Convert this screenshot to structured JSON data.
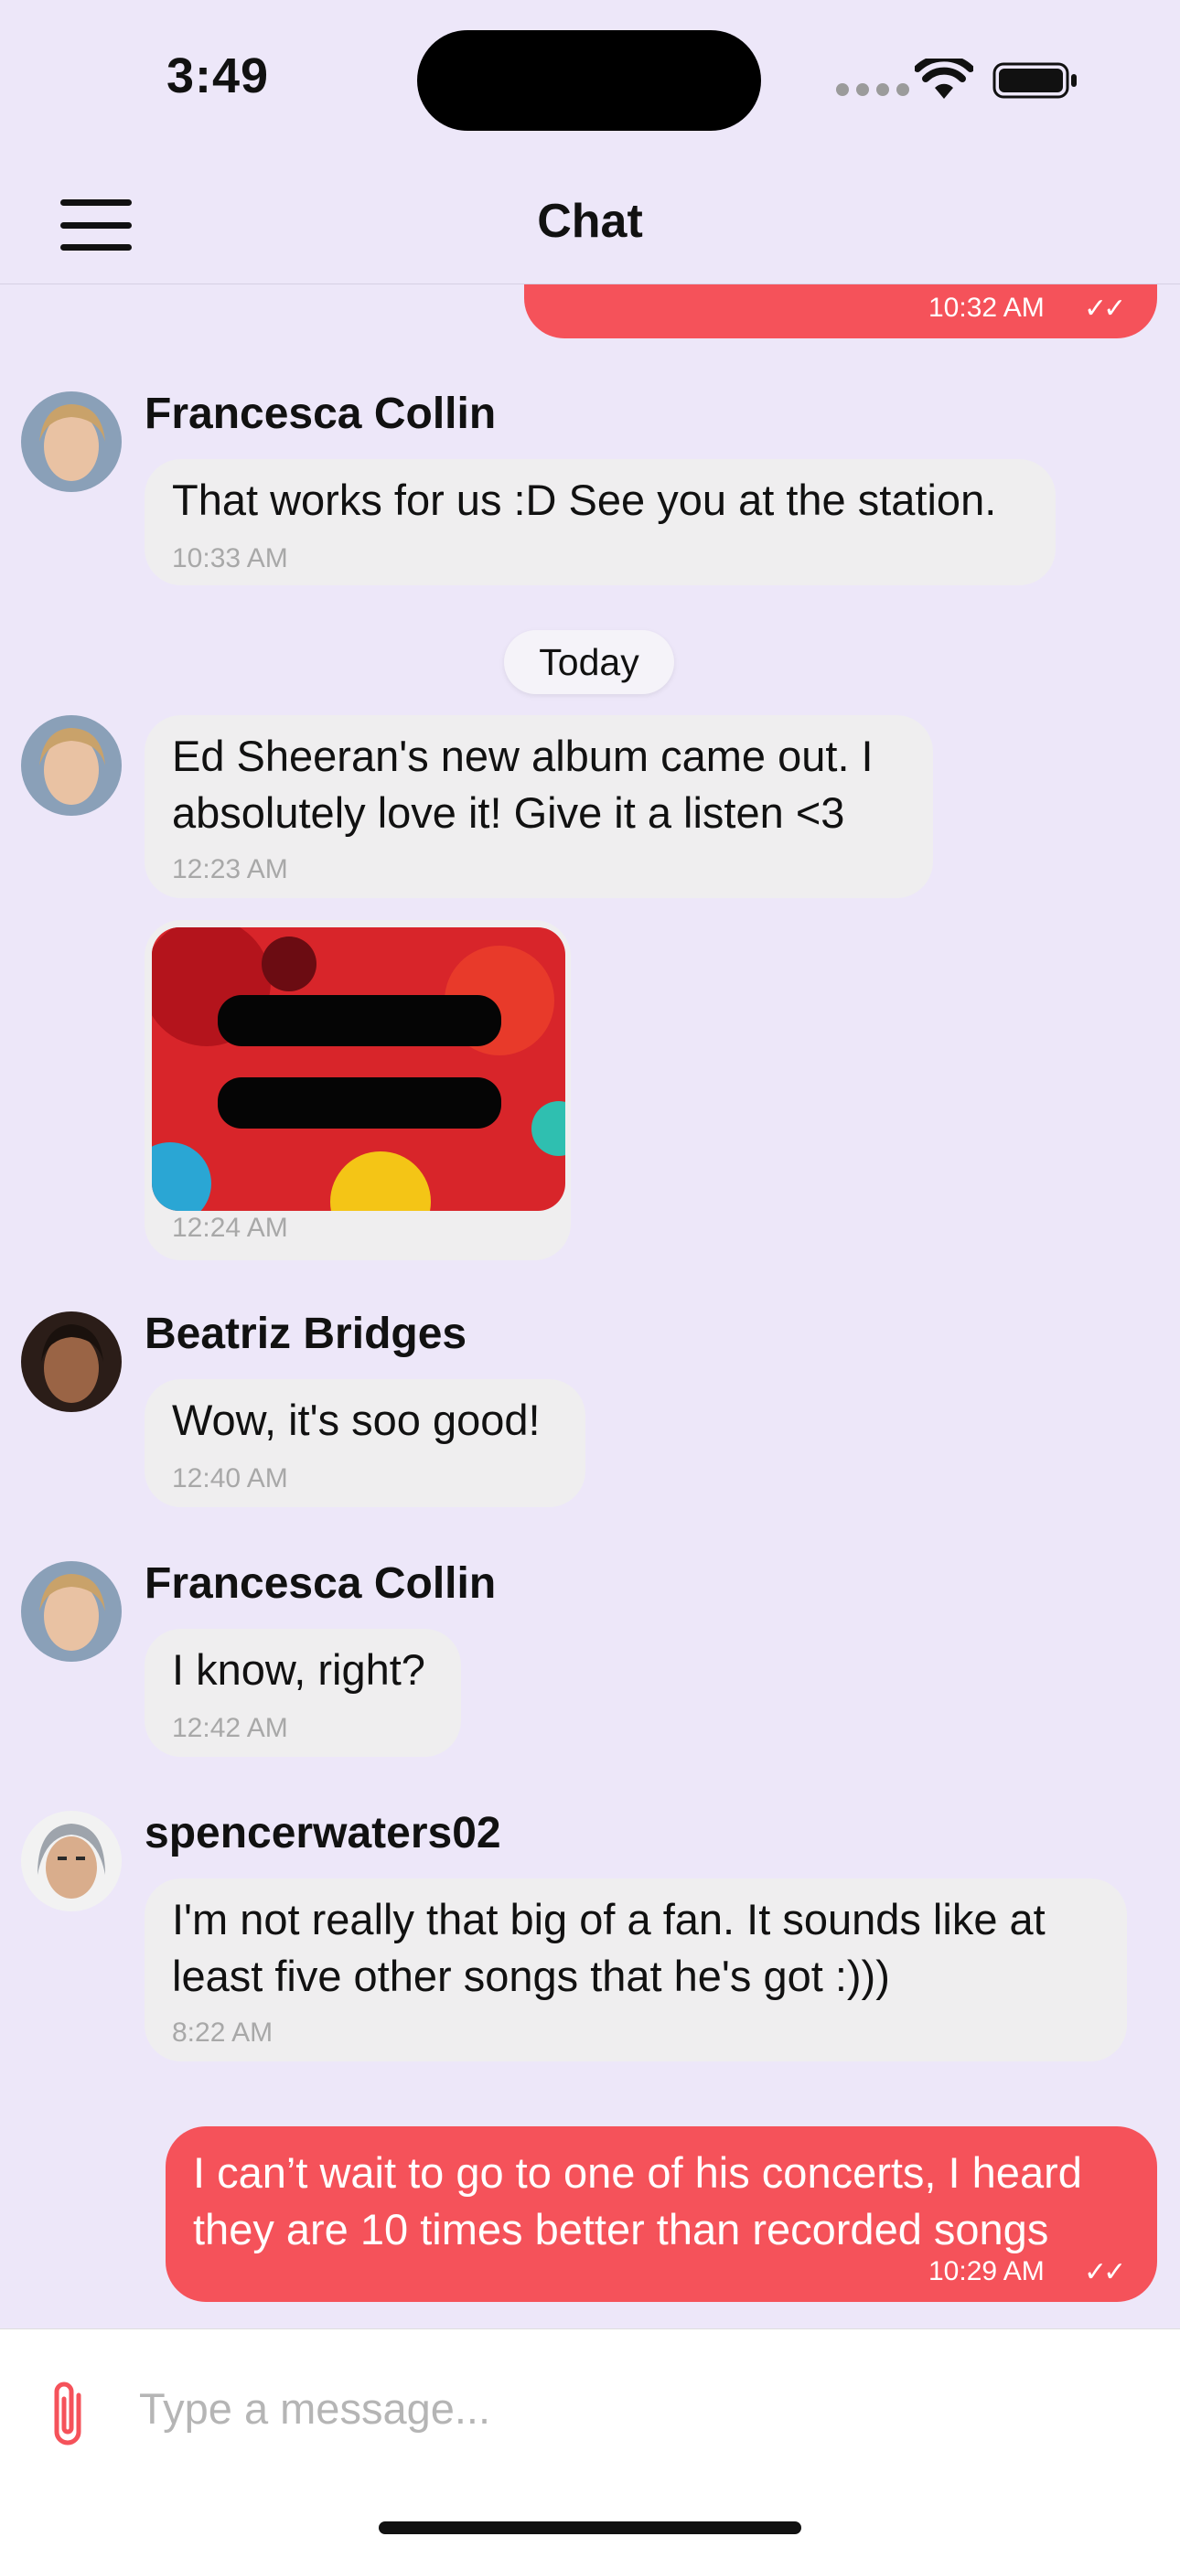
{
  "status_bar": {
    "time": "3:49"
  },
  "header": {
    "title": "Chat"
  },
  "messages": [
    {
      "direction": "out",
      "time": "10:32 AM",
      "ticks": "✓✓"
    },
    {
      "direction": "in",
      "sender": "Francesca Collin",
      "text": "That works for us :D See you at the station.",
      "time": "10:33 AM"
    },
    {
      "direction": "in",
      "sender": "",
      "text": "Ed Sheeran's new album came out. I absolutely love it! Give it a listen <3",
      "time": "12:23 AM"
    },
    {
      "direction": "in",
      "sender": "",
      "image": "album-cover",
      "time": "12:24 AM"
    },
    {
      "direction": "in",
      "sender": "Beatriz Bridges",
      "text": "Wow, it's soo good!",
      "time": "12:40 AM"
    },
    {
      "direction": "in",
      "sender": "Francesca Collin",
      "text": "I know, right?",
      "time": "12:42 AM"
    },
    {
      "direction": "in",
      "sender": "spencerwaters02",
      "text": "I'm not really that big of a fan. It sounds like at least five other songs that he's got :)))",
      "time": "8:22 AM"
    },
    {
      "direction": "out",
      "text": "I can’t wait to go to one of his concerts, I heard they are 10 times better than recorded songs",
      "time": "10:29 AM",
      "ticks": "✓✓"
    }
  ],
  "day_separator": "Today",
  "composer": {
    "placeholder": "Type a message..."
  },
  "colors": {
    "background": "#ede7f9",
    "outgoing_bubble": "#f5525a",
    "incoming_bubble": "#efeeef",
    "accent": "#f5525a"
  },
  "icons": [
    "menu-icon",
    "attachment-icon",
    "wifi-icon",
    "battery-icon",
    "signal-icon"
  ]
}
